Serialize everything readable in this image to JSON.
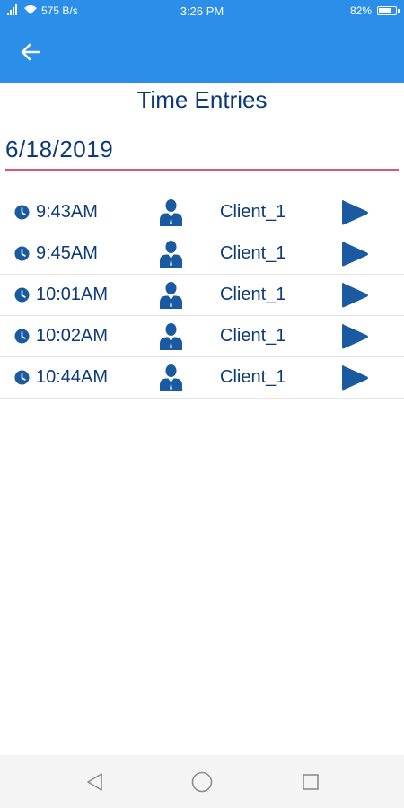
{
  "status_bar": {
    "network_speed": "575 B/s",
    "time": "3:26 PM",
    "battery_level": "82%",
    "battery_fraction": 0.82
  },
  "header": {
    "title": "Time Entries"
  },
  "date_field": {
    "value": "6/18/2019"
  },
  "entries": [
    {
      "time": "9:43AM",
      "client": "Client_1"
    },
    {
      "time": "9:45AM",
      "client": "Client_1"
    },
    {
      "time": "10:01AM",
      "client": "Client_1"
    },
    {
      "time": "10:02AM",
      "client": "Client_1"
    },
    {
      "time": "10:44AM",
      "client": "Client_1"
    }
  ],
  "icons": {
    "back": "arrow-left-icon",
    "clock": "clock-icon",
    "person": "person-icon",
    "play": "play-icon",
    "nav_back": "triangle-back-icon",
    "nav_home": "circle-home-icon",
    "nav_recents": "square-recents-icon"
  },
  "colors": {
    "primary": "#2b8ee8",
    "text": "#0d3b7a",
    "accent_underline": "#d9557a",
    "icon_dark": "#1a5aa0"
  }
}
